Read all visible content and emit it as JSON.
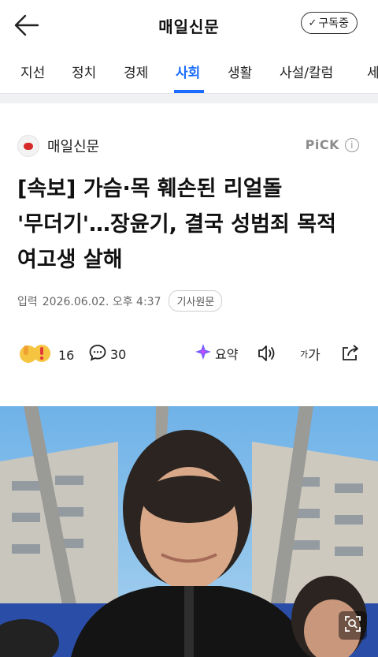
{
  "header": {
    "title": "매일신문",
    "subscribe_label": "구독중"
  },
  "tabs": [
    {
      "label": "지선"
    },
    {
      "label": "정치"
    },
    {
      "label": "경제"
    },
    {
      "label": "사회"
    },
    {
      "label": "생활"
    },
    {
      "label": "사설/칼럼"
    },
    {
      "label": "세"
    }
  ],
  "active_tab": "사회",
  "article": {
    "press_name": "매일신문",
    "pick_label": "PiCK",
    "headline": "[속보] 가슴·목 훼손된 리얼돌 '무더기'…장윤기, 결국 성범죄 목적 여고생 살해",
    "date_label": "입력",
    "date": "2026.06.02. 오후 4:37",
    "original_button": "기사원문"
  },
  "actions": {
    "reaction_count": "16",
    "comment_count": "30",
    "summary_label": "요약",
    "font_size_small": "가",
    "font_size_large": "가"
  },
  "colors": {
    "accent": "#1a6bff",
    "brand_red": "#d62a2a"
  }
}
